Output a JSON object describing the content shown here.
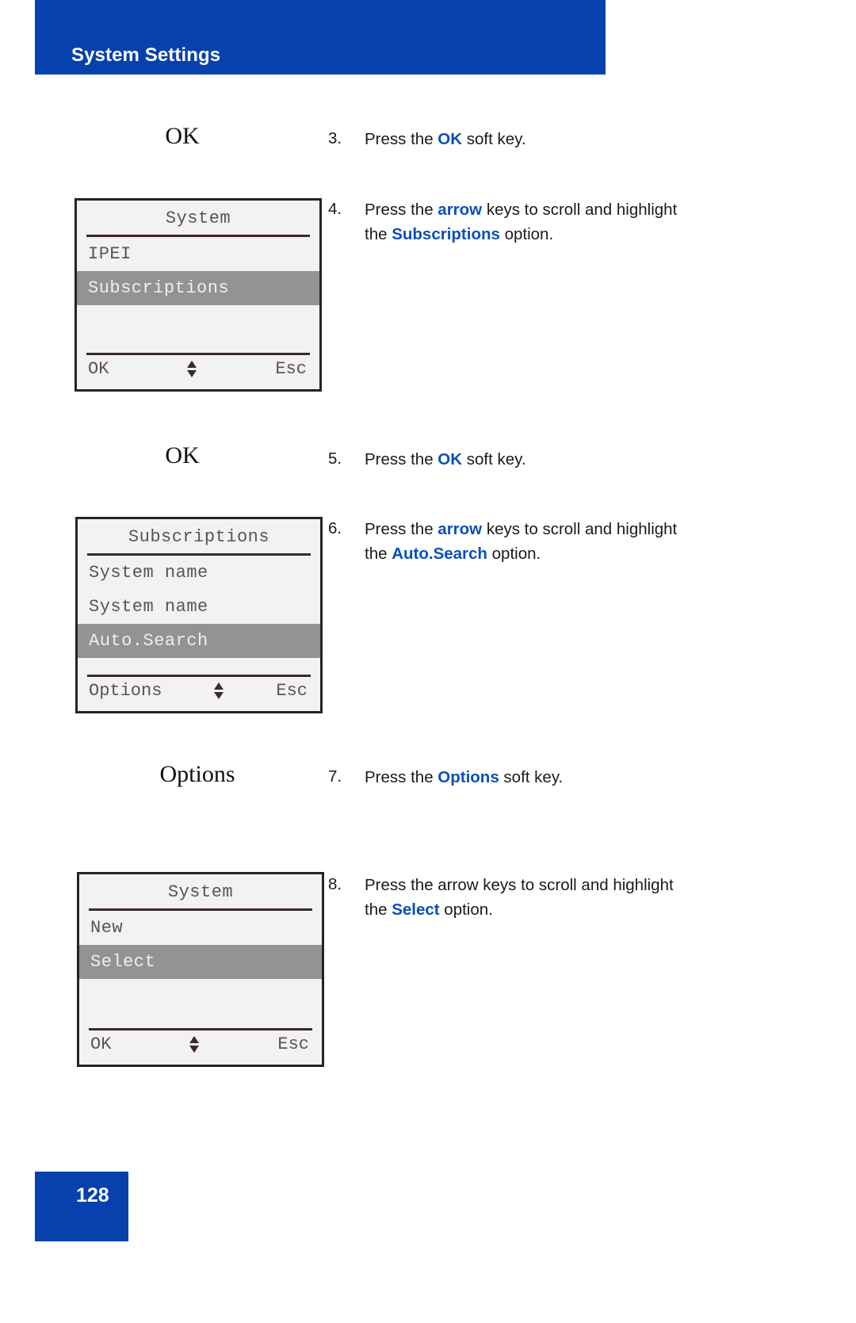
{
  "header": {
    "title": "System Settings"
  },
  "footer": {
    "page_number": "128",
    "accent_color": "#0641ad"
  },
  "colors": {
    "banner_blue": "#0641ad",
    "emphasis_blue": "#0b50b8",
    "lcd_background": "#f2f2f2",
    "lcd_border": "#2b2220",
    "lcd_highlight": "#939393",
    "lcd_text": "#5a5452"
  },
  "softkey_captions": [
    {
      "label": "OK"
    },
    {
      "label": "OK"
    },
    {
      "label": "Options"
    }
  ],
  "steps": [
    {
      "number": "3.",
      "parts": [
        {
          "text": "Press the ",
          "bold": false
        },
        {
          "text": "OK",
          "bold": true
        },
        {
          "text": " soft key.",
          "bold": false
        }
      ]
    },
    {
      "number": "4.",
      "parts": [
        {
          "text": "Press the ",
          "bold": false
        },
        {
          "text": "arrow",
          "bold": true
        },
        {
          "text": " keys to scroll and highlight the ",
          "bold": false
        },
        {
          "text": "Subscriptions",
          "bold": true
        },
        {
          "text": " option.",
          "bold": false
        }
      ]
    },
    {
      "number": "5.",
      "parts": [
        {
          "text": "Press the ",
          "bold": false
        },
        {
          "text": "OK",
          "bold": true
        },
        {
          "text": " soft key.",
          "bold": false
        }
      ]
    },
    {
      "number": "6.",
      "parts": [
        {
          "text": "Press the ",
          "bold": false
        },
        {
          "text": "arrow",
          "bold": true
        },
        {
          "text": " keys to scroll and highlight the ",
          "bold": false
        },
        {
          "text": "Auto.Search",
          "bold": true
        },
        {
          "text": " option.",
          "bold": false
        }
      ]
    },
    {
      "number": "7.",
      "parts": [
        {
          "text": "Press the ",
          "bold": false
        },
        {
          "text": "Options",
          "bold": true
        },
        {
          "text": " soft key.",
          "bold": false
        }
      ]
    },
    {
      "number": "8.",
      "parts": [
        {
          "text": "Press the arrow keys to scroll and highlight the ",
          "bold": false
        },
        {
          "text": "Select",
          "bold": true
        },
        {
          "text": " option.",
          "bold": false
        }
      ]
    }
  ],
  "screens": [
    {
      "title": "System",
      "items": [
        {
          "label": "IPEI",
          "selected": false
        },
        {
          "label": "Subscriptions",
          "selected": true
        }
      ],
      "softkeys": {
        "left": "OK",
        "middle_icon": "scroll-up-down-icon",
        "right": "Esc"
      }
    },
    {
      "title": "Subscriptions",
      "items": [
        {
          "label": "System name",
          "selected": false
        },
        {
          "label": "System name",
          "selected": false
        },
        {
          "label": "Auto.Search",
          "selected": true
        }
      ],
      "softkeys": {
        "left": "Options",
        "middle_icon": "scroll-up-down-icon",
        "right": "Esc"
      }
    },
    {
      "title": "System",
      "items": [
        {
          "label": "New",
          "selected": false
        },
        {
          "label": "Select",
          "selected": true
        }
      ],
      "softkeys": {
        "left": "OK",
        "middle_icon": "scroll-up-down-icon",
        "right": "Esc"
      }
    }
  ]
}
